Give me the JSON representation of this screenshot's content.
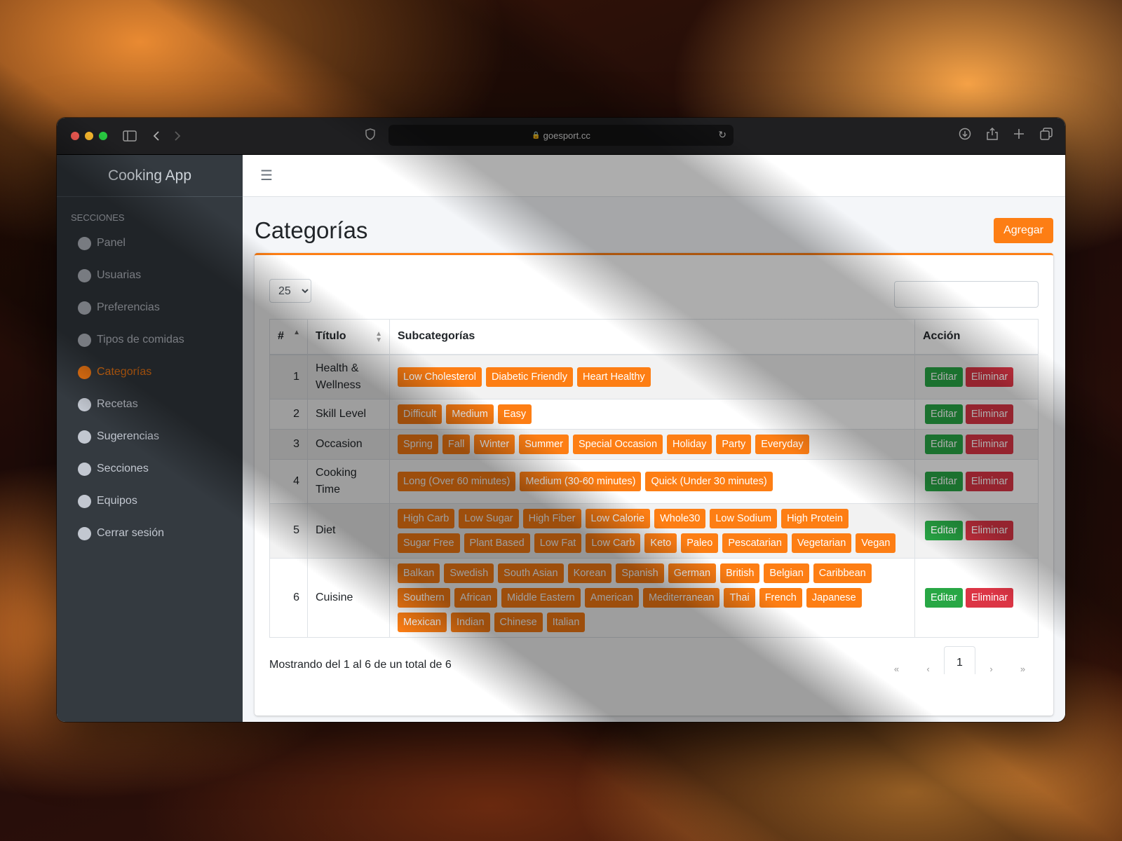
{
  "browser": {
    "url": "goesport.cc",
    "traffic_colors": [
      "#ff5f57",
      "#febc2e",
      "#28c840"
    ]
  },
  "sidebar": {
    "brand": "Cooking App",
    "section_label": "SECCIONES",
    "items": [
      {
        "label": "Panel",
        "active": false
      },
      {
        "label": "Usuarias",
        "active": false
      },
      {
        "label": "Preferencias",
        "active": false
      },
      {
        "label": "Tipos de comidas",
        "active": false
      },
      {
        "label": "Categorías",
        "active": true
      },
      {
        "label": "Recetas",
        "active": false
      },
      {
        "label": "Sugerencias",
        "active": false
      },
      {
        "label": "Secciones",
        "active": false
      },
      {
        "label": "Equipos",
        "active": false
      },
      {
        "label": "Cerrar sesión",
        "active": false
      }
    ]
  },
  "page": {
    "title": "Categorías",
    "add_label": "Agregar",
    "page_length": "25",
    "search_value": ""
  },
  "table": {
    "columns": [
      "#",
      "Título",
      "Subcategorías",
      "Acción"
    ],
    "edit_label": "Editar",
    "delete_label": "Eliminar",
    "rows": [
      {
        "num": "1",
        "title": "Health & Wellness",
        "subcategories": [
          "Low Cholesterol",
          "Diabetic Friendly",
          "Heart Healthy"
        ]
      },
      {
        "num": "2",
        "title": "Skill Level",
        "subcategories": [
          "Difficult",
          "Medium",
          "Easy"
        ]
      },
      {
        "num": "3",
        "title": "Occasion",
        "subcategories": [
          "Spring",
          "Fall",
          "Winter",
          "Summer",
          "Special Occasion",
          "Holiday",
          "Party",
          "Everyday"
        ]
      },
      {
        "num": "4",
        "title": "Cooking Time",
        "subcategories": [
          "Long (Over 60 minutes)",
          "Medium (30-60 minutes)",
          "Quick (Under 30 minutes)"
        ]
      },
      {
        "num": "5",
        "title": "Diet",
        "subcategories": [
          "High Carb",
          "Low Sugar",
          "High Fiber",
          "Low Calorie",
          "Whole30",
          "Low Sodium",
          "High Protein",
          "Sugar Free",
          "Plant Based",
          "Low Fat",
          "Low Carb",
          "Keto",
          "Paleo",
          "Pescatarian",
          "Vegetarian",
          "Vegan"
        ]
      },
      {
        "num": "6",
        "title": "Cuisine",
        "subcategories": [
          "Balkan",
          "Swedish",
          "South Asian",
          "Korean",
          "Spanish",
          "German",
          "British",
          "Belgian",
          "Caribbean",
          "Southern",
          "African",
          "Middle Eastern",
          "American",
          "Mediterranean",
          "Thai",
          "French",
          "Japanese",
          "Mexican",
          "Indian",
          "Chinese",
          "Italian"
        ]
      }
    ]
  },
  "footer": {
    "info": "Mostrando del 1 al 6 de un total de 6",
    "first": "«",
    "prev": "‹",
    "current_page": "1",
    "next": "›",
    "last": "»"
  },
  "colors": {
    "accent": "#fd7e14",
    "edit": "#28a745",
    "delete": "#dc3545",
    "sidebar": "#343a40"
  }
}
